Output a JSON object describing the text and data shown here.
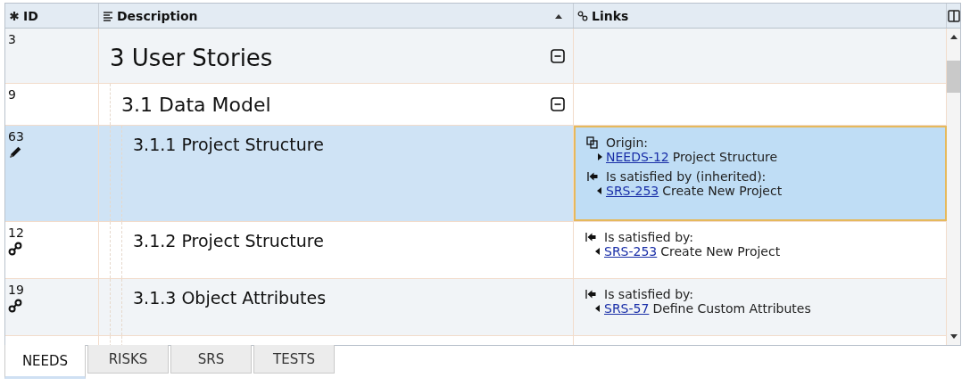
{
  "columns": [
    {
      "kind": "id",
      "label": "ID"
    },
    {
      "kind": "description",
      "label": "Description",
      "sorted": true
    },
    {
      "kind": "links",
      "label": "Links"
    }
  ],
  "rows": [
    {
      "id": "3",
      "title": "3 User Stories",
      "kind": "heading",
      "expanded": true,
      "selected": false,
      "children": [
        {
          "id": "9",
          "title": "3.1 Data Model",
          "kind": "heading",
          "expanded": true,
          "selected": false,
          "children": [
            {
              "id": "63",
              "title": "3.1.1 Project Structure",
              "kind": "modified",
              "selected": true,
              "links": [
                {
                  "kind": "origin",
                  "label": "Origin:",
                  "items": [
                    {
                      "ref": "NEEDS-12",
                      "title": "Project Structure"
                    }
                  ]
                },
                {
                  "kind": "satisfied",
                  "label": "Is satisfied by (inherited):",
                  "items": [
                    {
                      "ref": "SRS-253",
                      "title": "Create New Project"
                    }
                  ]
                }
              ]
            },
            {
              "id": "12",
              "title": "3.1.2 Project Structure",
              "kind": "linked",
              "selected": false,
              "links": [
                {
                  "kind": "satisfied",
                  "label": "Is satisfied by:",
                  "items": [
                    {
                      "ref": "SRS-253",
                      "title": "Create New Project"
                    }
                  ]
                }
              ]
            },
            {
              "id": "19",
              "title": "3.1.3 Object Attributes",
              "kind": "linked",
              "selected": false,
              "links": [
                {
                  "kind": "satisfied",
                  "label": "Is satisfied by:",
                  "items": [
                    {
                      "ref": "SRS-57",
                      "title": "Define Custom Attributes"
                    }
                  ]
                }
              ]
            }
          ]
        }
      ]
    }
  ],
  "tabs": [
    {
      "label": "NEEDS",
      "selected": true
    },
    {
      "label": "RISKS",
      "selected": false
    },
    {
      "label": "SRS",
      "selected": false
    },
    {
      "label": "TESTS",
      "selected": false
    }
  ]
}
